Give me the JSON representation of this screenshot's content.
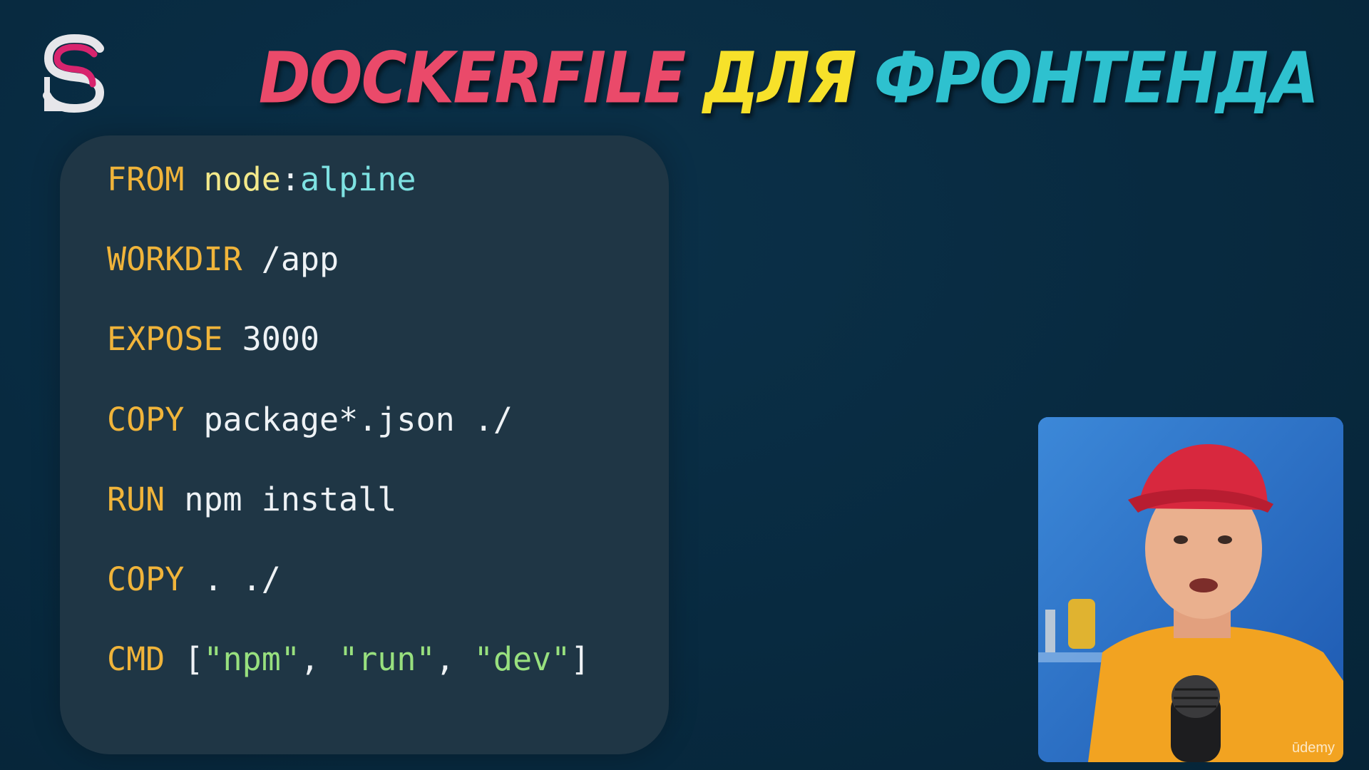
{
  "slide": {
    "title": {
      "part1": "DOCKERFILE",
      "part2": "ДЛЯ",
      "part3": "ФРОНТЕНДА"
    },
    "colors": {
      "background": "#082a40",
      "panel": "#1f3645",
      "keyword": "#f0b43a",
      "title_pink": "#ea4a6a",
      "title_yellow": "#f7e12a",
      "title_cyan": "#2ec1cf"
    }
  },
  "code": {
    "lines": [
      {
        "kw": "FROM",
        "rest": [
          {
            "t": "node",
            "c": "img"
          },
          {
            "t": ":",
            "c": "pl"
          },
          {
            "t": "alpine",
            "c": "tag"
          }
        ]
      },
      {
        "kw": "WORKDIR",
        "rest": [
          {
            "t": "/app",
            "c": "pl"
          }
        ]
      },
      {
        "kw": "EXPOSE",
        "rest": [
          {
            "t": "3000",
            "c": "pl"
          }
        ]
      },
      {
        "kw": "COPY",
        "rest": [
          {
            "t": "package*.json ./",
            "c": "pl"
          }
        ]
      },
      {
        "kw": "RUN",
        "rest": [
          {
            "t": "npm install",
            "c": "pl"
          }
        ]
      },
      {
        "kw": "COPY",
        "rest": [
          {
            "t": ". ./",
            "c": "pl"
          }
        ]
      },
      {
        "kw": "CMD",
        "rest": [
          {
            "t": "[",
            "c": "pl"
          },
          {
            "t": "\"npm\"",
            "c": "str"
          },
          {
            "t": ", ",
            "c": "pl"
          },
          {
            "t": "\"run\"",
            "c": "str"
          },
          {
            "t": ", ",
            "c": "pl"
          },
          {
            "t": "\"dev\"",
            "c": "str"
          },
          {
            "t": "]",
            "c": "pl"
          }
        ]
      }
    ]
  },
  "watermark": "ūdemy"
}
